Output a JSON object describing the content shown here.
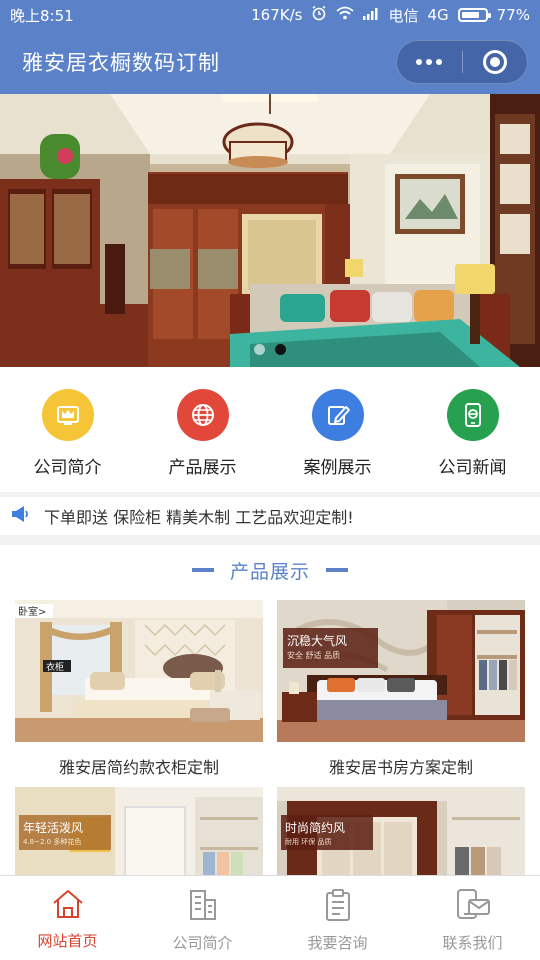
{
  "status": {
    "time": "晚上8:51",
    "speed": "167K/s",
    "carrier": "电信",
    "network": "4G",
    "battery_text": "77%",
    "battery_level": 0.77
  },
  "navbar": {
    "title": "雅安居衣橱数码订制",
    "more_icon": "more-dots-icon",
    "close_icon": "target-circle-icon"
  },
  "banner": {
    "slide_count": 2,
    "active_index": 1
  },
  "grid": [
    {
      "label": "公司简介",
      "icon": "crown-icon",
      "color": "#f5c437"
    },
    {
      "label": "产品展示",
      "icon": "globe-icon",
      "color": "#e2483a"
    },
    {
      "label": "案例展示",
      "icon": "edit-icon",
      "color": "#3e7ee0"
    },
    {
      "label": "公司新闻",
      "icon": "phone-e-icon",
      "color": "#27a04f"
    }
  ],
  "notice": {
    "text": "下单即送 保险柜 精美木制 工艺品欢迎定制!",
    "icon": "megaphone-icon"
  },
  "products": {
    "title": "产品展示",
    "items": [
      {
        "caption": "雅安居简约款衣柜定制",
        "tag": "卧室>",
        "sub_tag": "衣柜"
      },
      {
        "caption": "雅安居书房方案定制",
        "tag": "沉稳大气风",
        "sub_tag": "安全 舒适 品质"
      },
      {
        "caption": "",
        "tag": "年轻活泼风",
        "sub_tag": "4.8~2.0 多种花色"
      },
      {
        "caption": "",
        "tag": "时尚简约风",
        "sub_tag": "耐用 环保 品质"
      }
    ]
  },
  "tabbar": [
    {
      "label": "网站首页",
      "icon": "home-icon",
      "active": true
    },
    {
      "label": "公司简介",
      "icon": "building-icon",
      "active": false
    },
    {
      "label": "我要咨询",
      "icon": "clipboard-icon",
      "active": false
    },
    {
      "label": "联系我们",
      "icon": "contact-icon",
      "active": false
    }
  ],
  "colors": {
    "primary": "#5b82c9",
    "active_tab": "#d64530"
  }
}
